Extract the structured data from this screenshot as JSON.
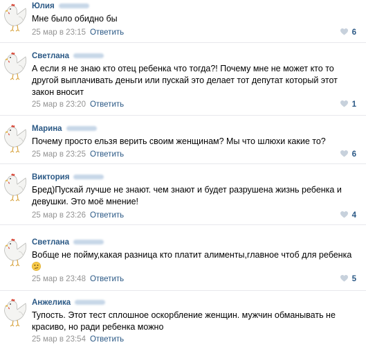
{
  "comments": [
    {
      "author": "Юлия",
      "text": "Мне было обидно бы",
      "date": "25 мар в 23:15",
      "reply_label": "Ответить",
      "likes": "6"
    },
    {
      "author": "Светлана",
      "text": "А если я не знаю кто отец ребенка что тогда?! Почему мне не может кто то другой выплачивать деньги или пускай это делает тот депутат который этот закон вносит",
      "date": "25 мар в 23:20",
      "reply_label": "Ответить",
      "likes": "1"
    },
    {
      "author": "Марина",
      "text": "Почему просто ельзя верить своим женщинам? Мы что шлюхи какие то?",
      "date": "25 мар в 23:25",
      "reply_label": "Ответить",
      "likes": "6"
    },
    {
      "author": "Виктория",
      "text": "Бред)Пускай лучше не знают. чем знают и будет разрушена жизнь ребенка и девушки. Это моё мнение!",
      "date": "25 мар в 23:26",
      "reply_label": "Ответить",
      "likes": "4"
    },
    {
      "author": "Светлана",
      "text": "Вобще не пойму,какая разница кто платит алименты,главное чтоб для ребенка",
      "emoji_icon": "confused-face-icon",
      "date": "25 мар в 23:48",
      "reply_label": "Ответить",
      "likes": "5"
    },
    {
      "author": "Анжелика",
      "text": "Тупость. Этот тест сплошное оскорбление женщин. мужчин обманывать не красиво, но ради ребенка можно",
      "date": "25 мар в 23:54",
      "reply_label": "Ответить",
      "likes": ""
    }
  ],
  "colors": {
    "link": "#2a5885",
    "meta": "#939393",
    "separator": "#e7e8ec",
    "heart": "#c7d1dc"
  },
  "icons": {
    "avatar": "white-chicken-avatar-icon",
    "like": "heart-icon"
  }
}
